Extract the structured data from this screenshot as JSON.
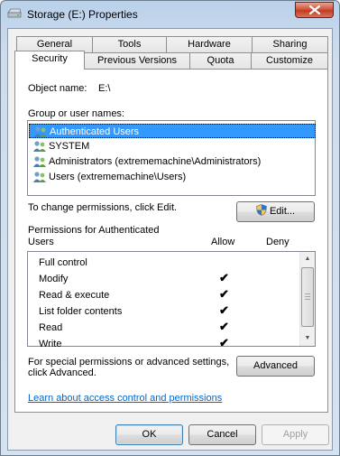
{
  "window": {
    "title": "Storage (E:) Properties"
  },
  "tabs": {
    "row1": [
      "General",
      "Tools",
      "Hardware",
      "Sharing"
    ],
    "row2": [
      "Security",
      "Previous Versions",
      "Quota",
      "Customize"
    ],
    "active": "Security"
  },
  "object": {
    "label": "Object name:",
    "value": "E:\\"
  },
  "groups": {
    "label": "Group or user names:",
    "items": [
      {
        "name": "Authenticated Users",
        "selected": true
      },
      {
        "name": "SYSTEM",
        "selected": false
      },
      {
        "name": "Administrators (extrememachine\\Administrators)",
        "selected": false
      },
      {
        "name": "Users (extrememachine\\Users)",
        "selected": false
      }
    ]
  },
  "change": {
    "text": "To change permissions, click Edit.",
    "edit_label": "Edit..."
  },
  "permissions": {
    "label_line1": "Permissions for Authenticated",
    "label_line2": "Users",
    "allow_header": "Allow",
    "deny_header": "Deny",
    "rows": [
      {
        "name": "Full control",
        "allow": false,
        "deny": false
      },
      {
        "name": "Modify",
        "allow": true,
        "deny": false
      },
      {
        "name": "Read & execute",
        "allow": true,
        "deny": false
      },
      {
        "name": "List folder contents",
        "allow": true,
        "deny": false
      },
      {
        "name": "Read",
        "allow": true,
        "deny": false
      },
      {
        "name": "Write",
        "allow": true,
        "deny": false
      }
    ],
    "check_glyph": "✔"
  },
  "special": {
    "line1": "For special permissions or advanced settings,",
    "line2": "click Advanced.",
    "advanced_label": "Advanced"
  },
  "link": {
    "text": "Learn about access control and permissions"
  },
  "buttons": {
    "ok": "OK",
    "cancel": "Cancel",
    "apply": "Apply"
  },
  "colors": {
    "selection": "#3399ff",
    "link": "#0066cc",
    "close": "#c33b22"
  }
}
